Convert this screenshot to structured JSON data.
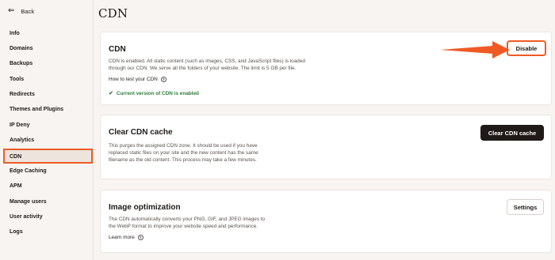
{
  "sidebar": {
    "back_label": "Back",
    "items": [
      {
        "label": "Info"
      },
      {
        "label": "Domains"
      },
      {
        "label": "Backups"
      },
      {
        "label": "Tools"
      },
      {
        "label": "Redirects"
      },
      {
        "label": "Themes and Plugins"
      },
      {
        "label": "IP Deny"
      },
      {
        "label": "Analytics"
      },
      {
        "label": "CDN"
      },
      {
        "label": "Edge Caching"
      },
      {
        "label": "APM"
      },
      {
        "label": "Manage users"
      },
      {
        "label": "User activity"
      },
      {
        "label": "Logs"
      }
    ],
    "active_item": "CDN"
  },
  "page": {
    "title": "CDN"
  },
  "cdn_card": {
    "title": "CDN",
    "description_line1": "CDN is enabled. All static content (such as images, CSS, and JavaScript files) is loaded",
    "description_line2": "through our CDN. We serve all the folders of your website. The limit is 5 GB per file.",
    "link": "How to test your CDN",
    "status": "Current version of CDN is enabled",
    "button": "Disable"
  },
  "cache_card": {
    "title": "Clear CDN cache",
    "description_line1": "This purges the assigned CDN zone. It should be used if you have",
    "description_line2": "replaced static files on your site and the new content has the same",
    "description_line3": "filename as the old content. This process may take a few minutes.",
    "button": "Clear CDN cache"
  },
  "image_card": {
    "title": "Image optimization",
    "description_line1": "The CDN automatically converts your PNG, GIF, and JPEG images to",
    "description_line2": "the WebP format to improve your website speed and performance.",
    "link": "Learn more",
    "button": "Settings"
  },
  "colors": {
    "accent": "#ef5a24",
    "success": "#2f7d3a",
    "background": "#f7f4f1",
    "dark_button": "#1f1a17"
  },
  "icons": [
    "back-arrow-icon",
    "help-icon",
    "check-circle-icon",
    "annotation-arrow-icon"
  ]
}
